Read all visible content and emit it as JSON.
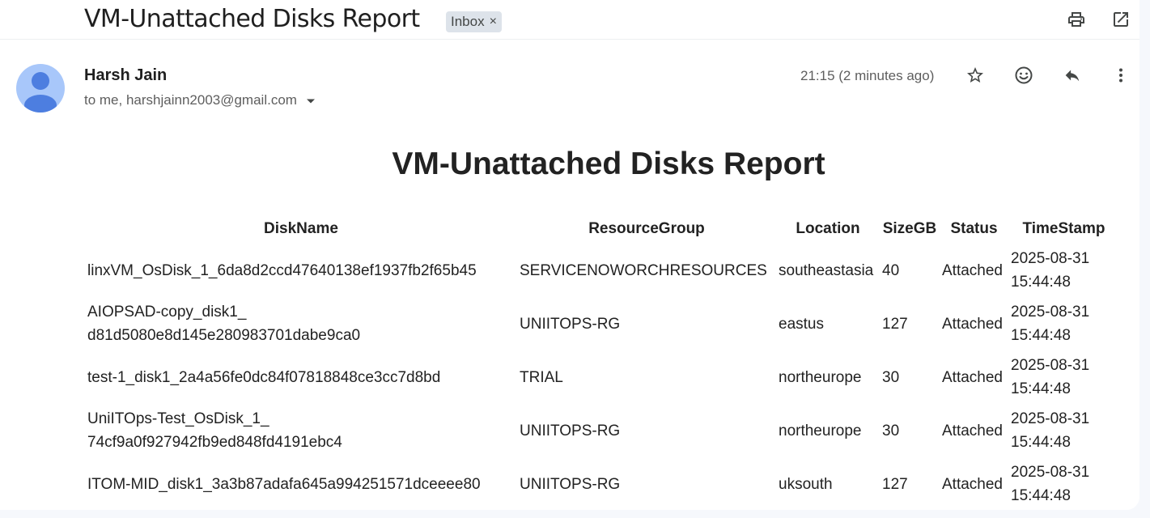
{
  "email": {
    "subject": "VM-Unattached Disks Report",
    "label": "Inbox",
    "label_remove_glyph": "×",
    "sender_name": "Harsh Jain",
    "recipients": "to me, harshjainn2003@gmail.com",
    "time": "21:15 (2 minutes ago)"
  },
  "icons": {
    "print": "printer-icon",
    "open_new_window": "open-in-new-window-icon",
    "star": "star-icon",
    "emoji": "emoji-reaction-icon",
    "reply": "reply-icon",
    "more": "more-vert-icon",
    "avatar": "default-avatar-icon",
    "caret": "dropdown-caret-icon"
  },
  "report": {
    "title": "VM-Unattached Disks Report",
    "headers": {
      "disk_name": "DiskName",
      "resource_group": "ResourceGroup",
      "location": "Location",
      "size_gb": "SizeGB",
      "status": "Status",
      "timestamp": "TimeStamp"
    },
    "rows": [
      {
        "disk_name_1": "linxVM_OsDisk_1_6da8d2ccd47640138ef1937fb2f65b45",
        "disk_name_2": "",
        "resource_group": "SERVICENOWORCHRESOURCES",
        "location": "southeastasia",
        "size_gb": "40",
        "status": "Attached",
        "date": "2025-08-31",
        "time": "15:44:48"
      },
      {
        "disk_name_1": "AIOPSAD-copy_disk1_",
        "disk_name_2": "d81d5080e8d145e280983701dabe9ca0",
        "resource_group": "UNIITOPS-RG",
        "location": "eastus",
        "size_gb": "127",
        "status": "Attached",
        "date": "2025-08-31",
        "time": "15:44:48"
      },
      {
        "disk_name_1": "test-1_disk1_2a4a56fe0dc84f07818848ce3cc7d8bd",
        "disk_name_2": "",
        "resource_group": "TRIAL",
        "location": "northeurope",
        "size_gb": "30",
        "status": "Attached",
        "date": "2025-08-31",
        "time": "15:44:48"
      },
      {
        "disk_name_1": "UniITOps-Test_OsDisk_1_",
        "disk_name_2": "74cf9a0f927942fb9ed848fd4191ebc4",
        "resource_group": "UNIITOPS-RG",
        "location": "northeurope",
        "size_gb": "30",
        "status": "Attached",
        "date": "2025-08-31",
        "time": "15:44:48"
      },
      {
        "disk_name_1": "ITOM-MID_disk1_3a3b87adafa645a994251571dceeee80",
        "disk_name_2": "",
        "resource_group": "UNIITOPS-RG",
        "location": "uksouth",
        "size_gb": "127",
        "status": "Attached",
        "date": "2025-08-31",
        "time": "15:44:48"
      }
    ]
  },
  "colors": {
    "page_background": "#f6f8fc",
    "card_background": "#ffffff",
    "label_chip": "#dde3ea",
    "avatar_background": "#a8c7fa",
    "avatar_figure": "#4d7ee0",
    "text_primary": "#1f1f1f",
    "text_secondary": "#5e5e5e",
    "icon": "#444746"
  }
}
